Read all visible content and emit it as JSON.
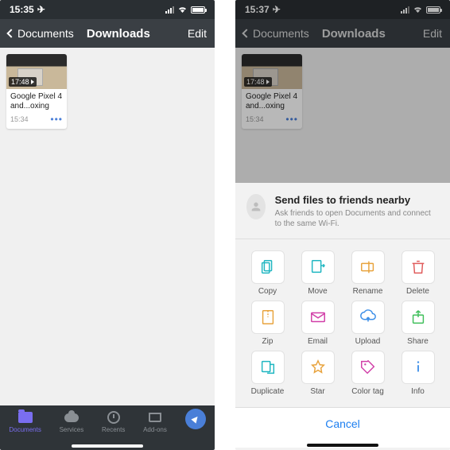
{
  "left": {
    "status_time": "15:35",
    "nav_back": "Documents",
    "nav_title": "Downloads",
    "nav_edit": "Edit",
    "file": {
      "duration": "17:48",
      "title": "Google Pixel 4 and...oxing",
      "time": "15:34"
    },
    "tabs": [
      "Documents",
      "Services",
      "Recents",
      "Add-ons"
    ]
  },
  "right": {
    "status_time": "15:37",
    "nav_back": "Documents",
    "nav_title": "Downloads",
    "nav_edit": "Edit",
    "file": {
      "duration": "17:48",
      "title": "Google Pixel 4 and...oxing",
      "time": "15:34"
    },
    "share": {
      "heading": "Send files to friends nearby",
      "subtext": "Ask friends to open Documents and connect to the same Wi-Fi."
    },
    "actions": [
      {
        "key": "copy",
        "label": "Copy",
        "color": "#1fb6c1"
      },
      {
        "key": "move",
        "label": "Move",
        "color": "#1fb6c1"
      },
      {
        "key": "rename",
        "label": "Rename",
        "color": "#e8a33d"
      },
      {
        "key": "delete",
        "label": "Delete",
        "color": "#e05b5b"
      },
      {
        "key": "zip",
        "label": "Zip",
        "color": "#e8a33d"
      },
      {
        "key": "email",
        "label": "Email",
        "color": "#d13fa8"
      },
      {
        "key": "upload",
        "label": "Upload",
        "color": "#3d8fe8"
      },
      {
        "key": "share",
        "label": "Share",
        "color": "#3fbf5a"
      },
      {
        "key": "duplicate",
        "label": "Duplicate",
        "color": "#1fb6c1"
      },
      {
        "key": "star",
        "label": "Star",
        "color": "#e8a33d"
      },
      {
        "key": "colortag",
        "label": "Color tag",
        "color": "#d13fa8"
      },
      {
        "key": "info",
        "label": "Info",
        "color": "#3d8fe8"
      }
    ],
    "cancel": "Cancel"
  }
}
